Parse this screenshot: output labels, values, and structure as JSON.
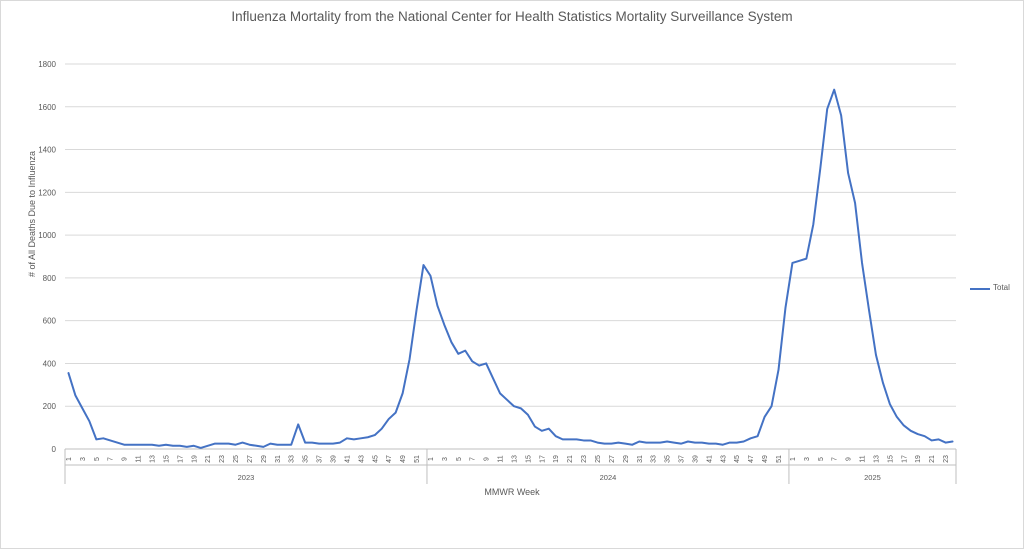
{
  "chart_data": {
    "type": "line",
    "title": "Influenza Mortality from the National Center for Health Statistics Mortality Surveillance System",
    "xlabel": "MMWR Week",
    "ylabel": "# of All Deaths Due to Influenza",
    "ylim": [
      0,
      1800
    ],
    "yticks": [
      0,
      200,
      400,
      600,
      800,
      1000,
      1200,
      1400,
      1600,
      1800
    ],
    "grid": true,
    "legend_position": "right",
    "line_color": "#4472c4",
    "years": [
      {
        "label": "2023",
        "weeks": 52,
        "tick_labels": [
          "1",
          "3",
          "5",
          "7",
          "9",
          "11",
          "13",
          "15",
          "17",
          "19",
          "21",
          "23",
          "25",
          "27",
          "29",
          "31",
          "33",
          "35",
          "37",
          "39",
          "41",
          "43",
          "45",
          "47",
          "49",
          "51"
        ]
      },
      {
        "label": "2024",
        "weeks": 52,
        "tick_labels": [
          "1",
          "3",
          "5",
          "7",
          "9",
          "11",
          "13",
          "15",
          "17",
          "19",
          "21",
          "23",
          "25",
          "27",
          "29",
          "31",
          "33",
          "35",
          "37",
          "39",
          "41",
          "43",
          "45",
          "47",
          "49",
          "51"
        ]
      },
      {
        "label": "2025",
        "weeks": 24,
        "tick_labels": [
          "1",
          "3",
          "5",
          "7",
          "9",
          "11",
          "13",
          "15",
          "17",
          "19",
          "21",
          "23"
        ]
      }
    ],
    "series": [
      {
        "name": "Total",
        "values": [
          355,
          250,
          190,
          130,
          45,
          50,
          40,
          30,
          20,
          20,
          20,
          20,
          20,
          15,
          20,
          15,
          15,
          10,
          15,
          5,
          15,
          25,
          25,
          25,
          20,
          30,
          20,
          15,
          10,
          25,
          20,
          20,
          20,
          115,
          30,
          30,
          25,
          25,
          25,
          30,
          50,
          45,
          50,
          55,
          65,
          95,
          140,
          170,
          260,
          420,
          650,
          860,
          810,
          670,
          580,
          500,
          445,
          460,
          410,
          390,
          400,
          330,
          260,
          230,
          200,
          190,
          160,
          105,
          85,
          95,
          60,
          45,
          45,
          45,
          40,
          40,
          30,
          25,
          25,
          30,
          25,
          20,
          35,
          30,
          30,
          30,
          35,
          30,
          25,
          35,
          30,
          30,
          25,
          25,
          20,
          30,
          30,
          35,
          50,
          60,
          150,
          200,
          370,
          660,
          870,
          880,
          890,
          1050,
          1310,
          1590,
          1680,
          1560,
          1290,
          1150,
          870,
          650,
          440,
          310,
          210,
          150,
          110,
          85,
          70,
          60,
          40,
          45,
          30,
          35
        ]
      }
    ]
  }
}
